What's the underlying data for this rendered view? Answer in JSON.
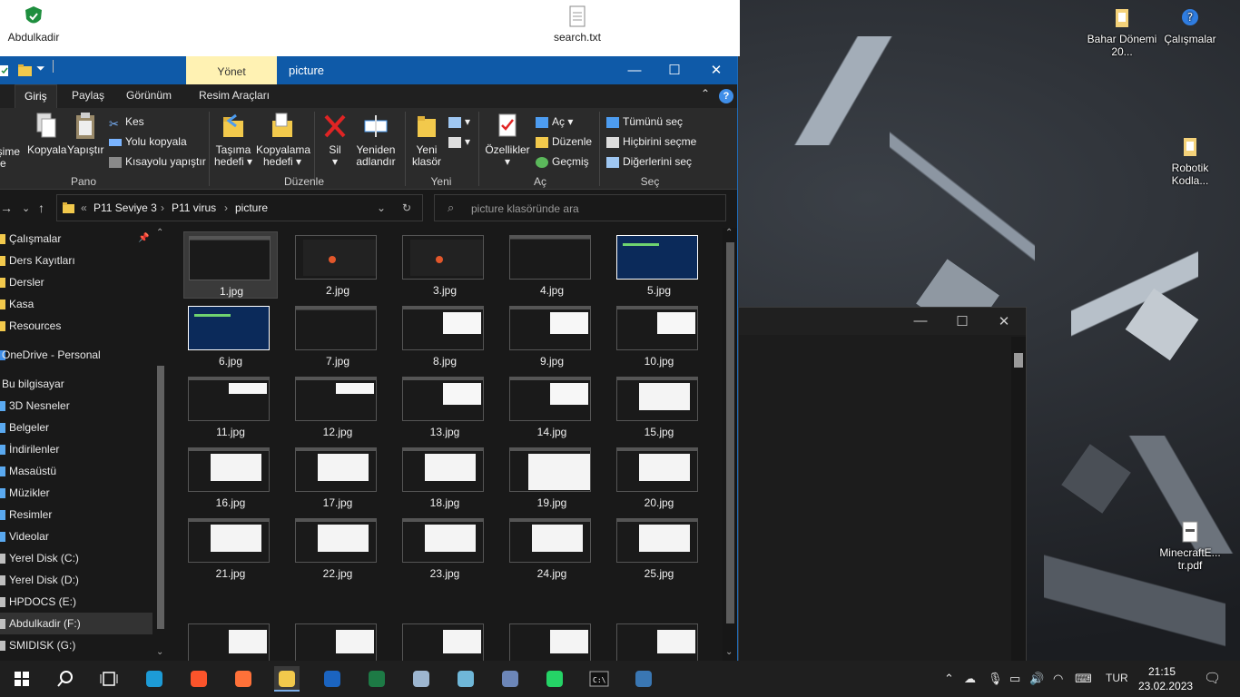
{
  "desktop": {
    "icons": [
      {
        "id": "abdulkadir",
        "label": "Abdulkadir"
      },
      {
        "id": "search",
        "label": "search.txt"
      },
      {
        "id": "bahar",
        "label": "Bahar Dönemi 20..."
      },
      {
        "id": "calismalar",
        "label": "Çalışmalar"
      },
      {
        "id": "robotik",
        "label": "Robotik Kodla..."
      },
      {
        "id": "minecraft",
        "label": "MinecraftE... tr.pdf"
      }
    ]
  },
  "explorer": {
    "title": "picture",
    "manage_tab": "Yönet",
    "tabs": [
      "Giriş",
      "Paylaş",
      "Görünüm",
      "Resim Araçları"
    ],
    "help": "?",
    "ribbon": {
      "pin_label": "işime\ntle",
      "copy": "Kopyala",
      "paste": "Yapıştır",
      "cut": "Kes",
      "copy_path": "Yolu kopyala",
      "paste_shortcut": "Kısayolu yapıştır",
      "group_pano": "Pano",
      "move_to": "Taşıma hedefi",
      "copy_to": "Kopyalama hedefi",
      "delete": "Sil",
      "rename": "Yeniden adlandır",
      "group_duzenle": "Düzenle",
      "new_folder": "Yeni klasör",
      "group_yeni": "Yeni",
      "properties": "Özellikler",
      "open": "Aç",
      "edit": "Düzenle",
      "history": "Geçmiş",
      "group_ac": "Aç",
      "select_all": "Tümünü seç",
      "select_none": "Hiçbirini seçme",
      "invert_selection": "Diğerlerini seç",
      "group_sec": "Seç"
    },
    "address": {
      "overflow": "«",
      "crumbs": [
        "P11 Seviye 3",
        "P11 virus",
        "picture"
      ]
    },
    "search_placeholder": "picture klasöründe ara",
    "nav_items": [
      {
        "label": "Çalışmalar",
        "pinned": true
      },
      {
        "label": "Ders Kayıtları"
      },
      {
        "label": "Dersler"
      },
      {
        "label": "Kasa"
      },
      {
        "label": "Resources"
      },
      {
        "label": "OneDrive - Personal"
      },
      {
        "label": "Bu bilgisayar"
      },
      {
        "label": "3D Nesneler"
      },
      {
        "label": "Belgeler"
      },
      {
        "label": "İndirilenler"
      },
      {
        "label": "Masaüstü"
      },
      {
        "label": "Müzikler"
      },
      {
        "label": "Resimler"
      },
      {
        "label": "Videolar"
      },
      {
        "label": "Yerel Disk (C:)"
      },
      {
        "label": "Yerel Disk (D:)"
      },
      {
        "label": "HPDOCS (E:)"
      },
      {
        "label": "Abdulkadir (F:)",
        "selected": true
      },
      {
        "label": "SMIDISK (G:)"
      }
    ],
    "files": [
      "1.jpg",
      "2.jpg",
      "3.jpg",
      "4.jpg",
      "5.jpg",
      "6.jpg",
      "7.jpg",
      "8.jpg",
      "9.jpg",
      "10.jpg",
      "11.jpg",
      "12.jpg",
      "13.jpg",
      "14.jpg",
      "15.jpg",
      "16.jpg",
      "17.jpg",
      "18.jpg",
      "19.jpg",
      "20.jpg",
      "21.jpg",
      "22.jpg",
      "23.jpg",
      "24.jpg",
      "25.jpg"
    ],
    "selected_file": "1.jpg"
  },
  "taskbar": {
    "apps": [
      "start-icon",
      "search-icon",
      "task-view-icon",
      "edge-icon",
      "brave-icon",
      "firefox-icon",
      "file-explorer-icon",
      "outlook-icon",
      "excel-icon",
      "app-cube-icon",
      "app-blue-icon",
      "calculator-icon",
      "whatsapp-icon",
      "terminal-icon",
      "python-icon"
    ],
    "language": "TUR",
    "time": "21:15",
    "date": "23.02.2023"
  },
  "colors": {
    "titlebar": "#0f5aa8",
    "manage_tab": "#fff2b3",
    "folder": "#f2c94c",
    "accent": "#3f8ee8"
  }
}
